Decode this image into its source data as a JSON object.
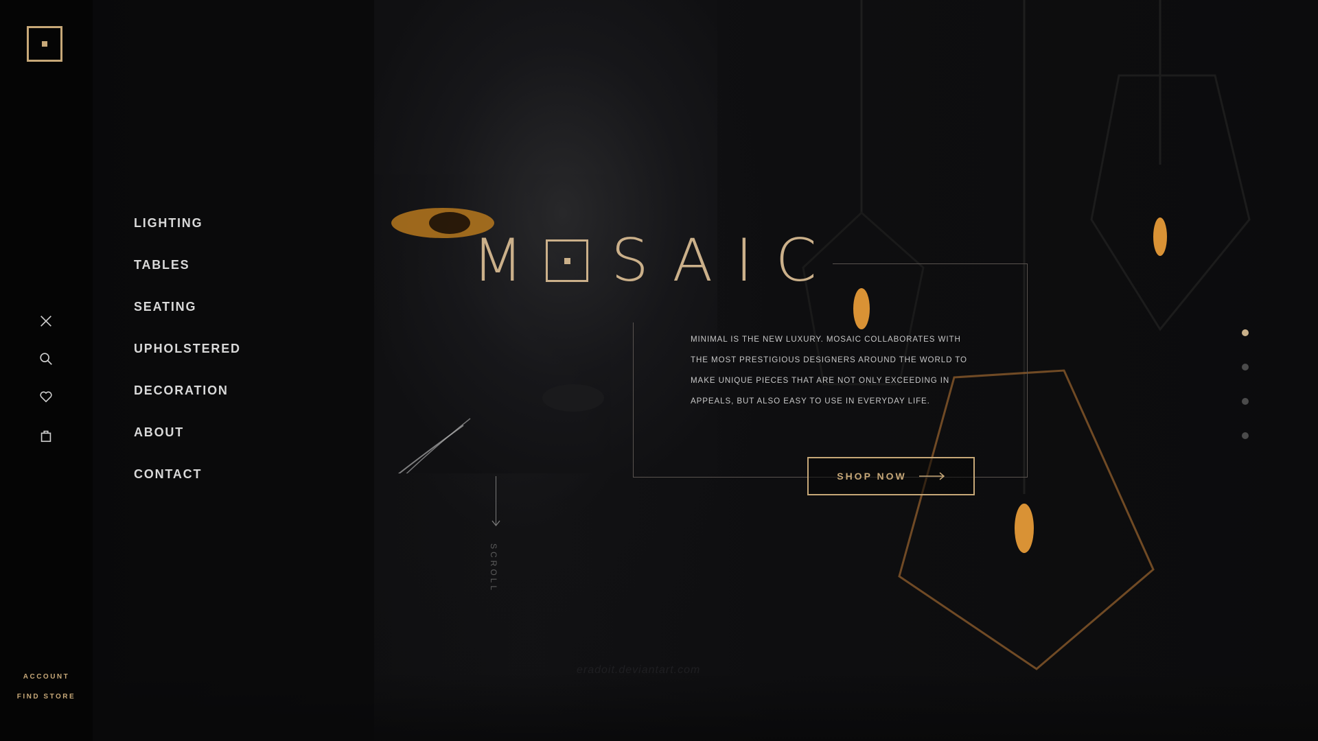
{
  "brand": {
    "name_left": "M",
    "name_right": "SAIC"
  },
  "sidebar": {
    "icons": [
      "close-icon",
      "search-icon",
      "heart-icon",
      "shopping-bag-icon"
    ],
    "links": {
      "account": "ACCOUNT",
      "find_store": "FIND STORE"
    }
  },
  "menu": {
    "items": [
      {
        "label": "LIGHTING"
      },
      {
        "label": "TABLES"
      },
      {
        "label": "SEATING"
      },
      {
        "label": "UPHOLSTERED"
      },
      {
        "label": "DECORATION"
      },
      {
        "label": "ABOUT"
      },
      {
        "label": "CONTACT"
      }
    ]
  },
  "hero": {
    "description_lines": [
      "MINIMAL IS THE NEW LUXURY. MOSAIC COLLABORATES WITH",
      "THE MOST PRESTIGIOUS DESIGNERS AROUND THE WORLD TO",
      "MAKE UNIQUE PIECES THAT ARE NOT ONLY EXCEEDING IN",
      "APPEALS, BUT ALSO EASY TO USE IN EVERYDAY LIFE."
    ],
    "cta_label": "SHOP NOW",
    "scroll_label": "SCROLL"
  },
  "slider": {
    "total": 4,
    "active_index": 0
  },
  "watermark": "eradoit.deviantart.com",
  "colors": {
    "accent": "#c7a878",
    "background": "#0d0d0e",
    "text": "#d9d9d9"
  }
}
